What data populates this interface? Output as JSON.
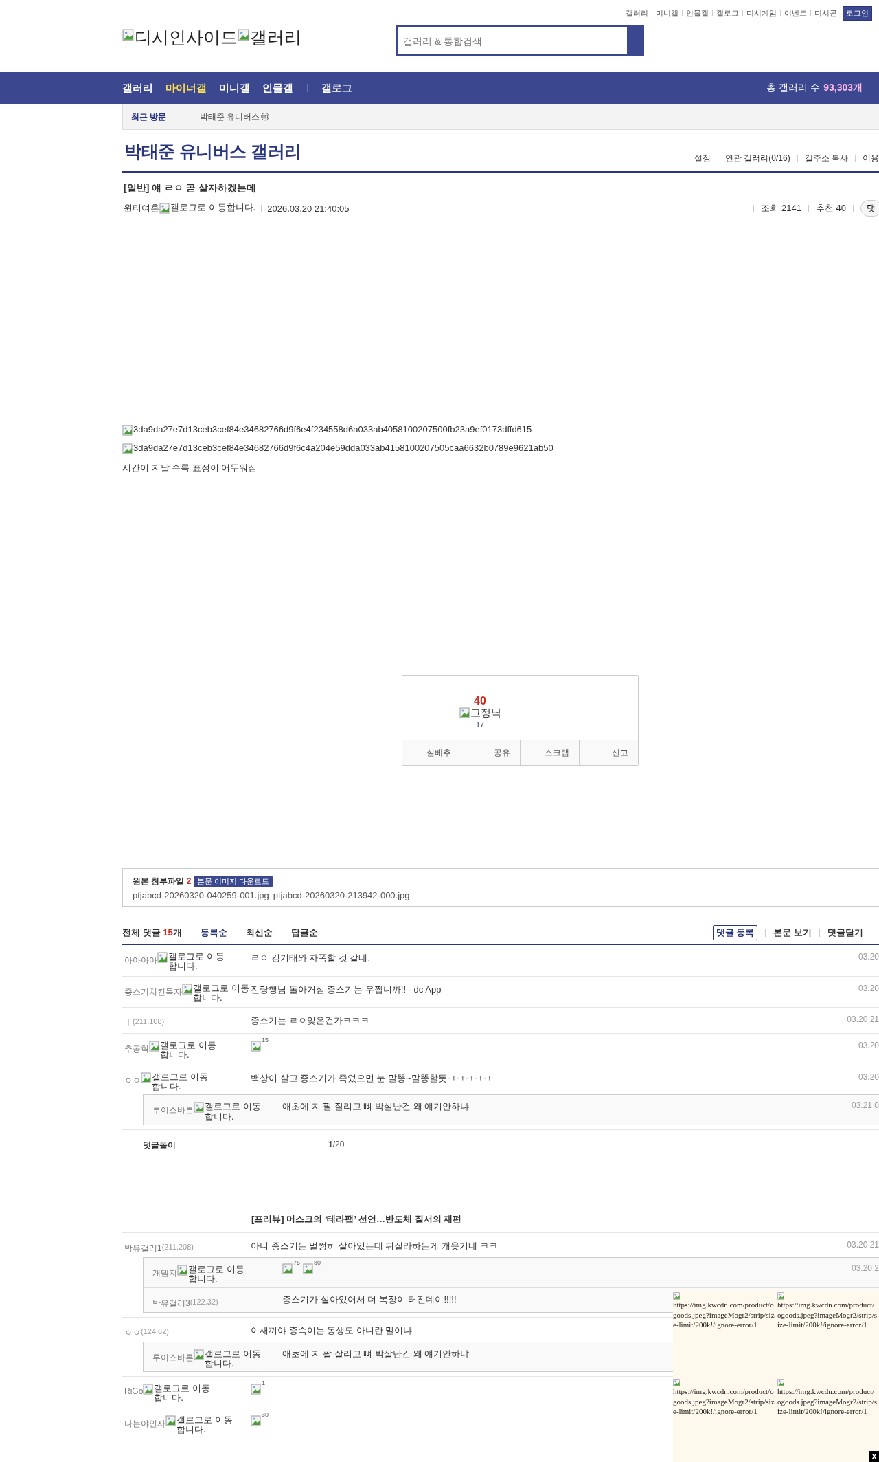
{
  "top_links": [
    "갤러리",
    "미니갤",
    "인물갤",
    "갤로그",
    "디시게임",
    "이벤트",
    "디시콘"
  ],
  "login_button": "로그인",
  "logo": {
    "alts": [
      "디시인사이드",
      "갤러리"
    ]
  },
  "search": {
    "placeholder": "갤러리 & 통합검색"
  },
  "nav": {
    "items": [
      {
        "label": "갤러리",
        "selected": false
      },
      {
        "label": "마이너갤",
        "selected": true
      },
      {
        "label": "미니갤",
        "selected": false
      },
      {
        "label": "인물갤",
        "selected": false
      },
      {
        "label": "갤로그",
        "selected": false
      }
    ],
    "total_label": "총 갤러리 수",
    "total_count": "93,303개"
  },
  "recent": {
    "label": "최근 방문",
    "items": [
      {
        "name": "박태준 유니버스",
        "badge": "ⓜ"
      }
    ]
  },
  "gallery": {
    "title": "박태준 유니버스 갤러리",
    "actions": [
      "설정",
      "연관 갤러리(0/16)",
      "갤주소 복사",
      "이용"
    ]
  },
  "post": {
    "head": "[일반]",
    "title": "얘 ㄹㅇ 곧 살자하겠는데",
    "author": "윈터여훈",
    "gallog_alt": "갤로그로 이동합니다.",
    "date": "2026.03.20 21:40:05",
    "views": "조회 2141",
    "recommends": "추천 40",
    "comment_button": "댓",
    "image_alts": [
      "3da9da27e7d13ceb3cef84e34682766d9f6e4f234558d6a033ab4058100207500fb23a9ef0173dffd615",
      "3da9da27e7d13ceb3cef84e34682766d9f6c4a204e59dda033ab4158100207505caa6632b0789e9621ab50"
    ],
    "text": "시간이 지날 수록 표정이 어두워짐"
  },
  "recommend_box": {
    "count": "40",
    "fixed_alt": "고정닉",
    "fixed_count": "17",
    "buttons": [
      "실베추",
      "공유",
      "스크랩",
      "신고"
    ]
  },
  "attachments": {
    "label": "원본 첨부파일",
    "count": "2",
    "download_button": "본문 이미지 다운로드",
    "files": [
      "ptjabcd-20260320-040259-001.jpg",
      "ptjabcd-20260320-213942-000.jpg"
    ]
  },
  "comments_header": {
    "label": "전체 댓글",
    "count": "15",
    "unit": "개",
    "sorts": [
      {
        "label": "등록순",
        "selected": true
      },
      {
        "label": "최신순",
        "selected": false
      },
      {
        "label": "답글순",
        "selected": false
      }
    ],
    "register_button": "댓글 등록",
    "actions": [
      "본문 보기",
      "댓글닫기"
    ]
  },
  "comments": [
    {
      "kind": "text",
      "author": "아아아아",
      "gallog_alt": "갤로그로 이동합니다.",
      "text": "ㄹㅇ 김기태와 자폭할 것 같네.",
      "date": "03.20"
    },
    {
      "kind": "text",
      "author": "증스기치킨묵자",
      "gallog_alt": "갤로그로 이동합니다.",
      "text": "진랑행님 돌아거심 증스기는 우짭니까!! - dc App",
      "date": "03.20"
    },
    {
      "kind": "text",
      "author": "ㅣ",
      "ip": "(211.108)",
      "text": "증스기는 ㄹㅇ잊은건가ㅋㅋㅋ",
      "date": "03.20 21"
    },
    {
      "kind": "image",
      "author": "추공혁",
      "gallog_alt": "갤로그로 이동합니다.",
      "image_alts": [
        "15"
      ],
      "date": "03.20"
    },
    {
      "kind": "text",
      "author": "ㅇㅇ",
      "gallog_alt": "갤로그로 이동합니다.",
      "text": "백상이 살고 증스기가 죽었으면 눈 말똥~말똥할듯ㅋㅋㅋㅋㅋ",
      "date": "03.20",
      "replies": [
        {
          "kind": "text",
          "author": "루이스바튼",
          "gallog_alt": "갤로그로 이동합니다.",
          "text": "애초에 지 팔 잘리고 뼈 박살난건 왜 얘기안하냐",
          "date": "03.21 0"
        }
      ]
    },
    {
      "kind": "bot",
      "author": "댓글돌이",
      "page": "**1**/20",
      "headline": "[프리뷰] 머스크의 ‘테라팹’ 선언…반도체 질서의 재편"
    },
    {
      "kind": "text",
      "author": "박유갤러1",
      "ip": "(211.208)",
      "text": "아니 증스기는 멀쩡히 살아있는데 뒤질라하는게 개웃기네 ㅋㅋ",
      "date": "03.20 21",
      "replies": [
        {
          "kind": "image",
          "author": "개댐지",
          "gallog_alt": "갤로그로 이동합니다.",
          "image_alts": [
            "75",
            "80"
          ],
          "date": "03.20 2"
        },
        {
          "kind": "text",
          "author": "박유갤러3",
          "ip": "(122.32)",
          "text": "증스기가 살아있어서 더 복장이 터진데이!!!!!"
        }
      ]
    },
    {
      "kind": "text",
      "author": "ㅇㅇ",
      "ip": "(124.62)",
      "text": "이새끼야 증슥이는 동생도 아니란 말이냐",
      "replies": [
        {
          "kind": "text",
          "author": "루이스바튼",
          "gallog_alt": "갤로그로 이동합니다.",
          "text": "애초에 지 팔 잘리고 뼈 박살난건 왜 얘기안하냐"
        }
      ]
    },
    {
      "kind": "image",
      "author": "RiGo",
      "gallog_alt": "갤로그로 이동합니다.",
      "image_alts": [
        "1"
      ]
    },
    {
      "kind": "image",
      "author": "나는야인사",
      "gallog_alt": "갤로그로 이동합니다.",
      "image_alts": [
        "30"
      ]
    }
  ],
  "ad": {
    "image_alts": [
      "https://img.kwcdn.com/product/ogoods.jpeg?imageMogr2/strip/size-limit/200k!/ignore-error/1",
      "https://img.kwcdn.com/product/ogoods.jpeg?imageMogr2/strip/size-limit/200k!/ignore-error/1",
      "https://img.kwcdn.com/product/ogoods.jpeg?imageMogr2/strip/size-limit/200k!/ignore-error/1",
      "https://img.kwcdn.com/product/ogoods.jpeg?imageMogr2/strip/size-limit/200k!/ignore-error/1"
    ],
    "close_button": "X"
  }
}
